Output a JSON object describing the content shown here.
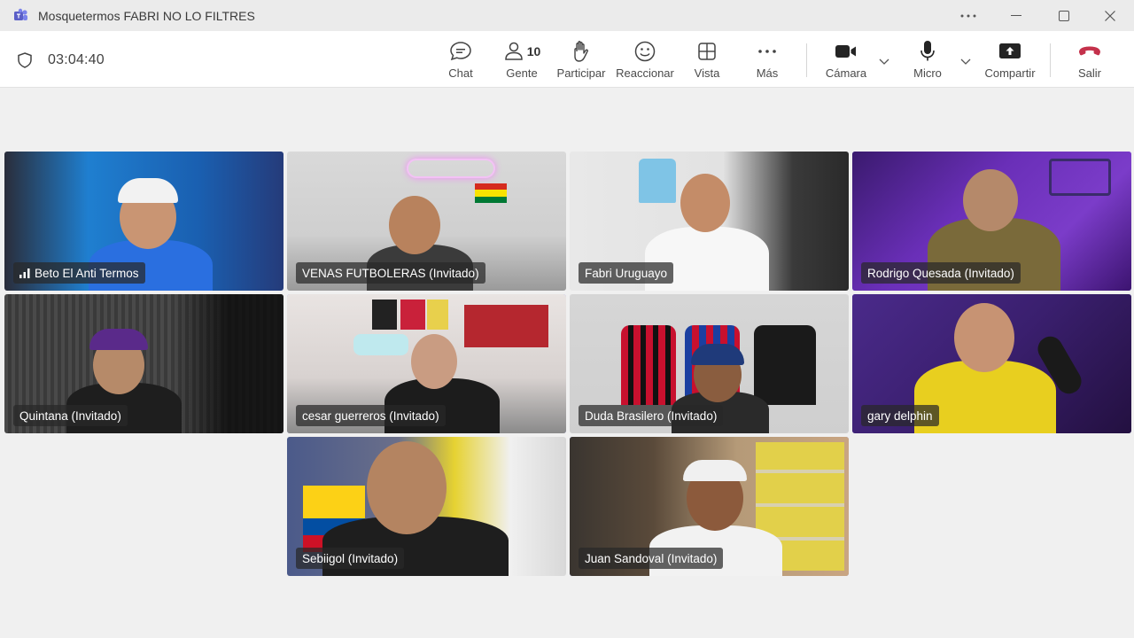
{
  "window": {
    "title": "Mosquetermos FABRI NO LO FILTRES"
  },
  "toolbar": {
    "timer": "03:04:40",
    "chat": "Chat",
    "people": "Gente",
    "people_count": "10",
    "raise_hand": "Participar",
    "react": "Reaccionar",
    "view": "Vista",
    "more": "Más",
    "camera": "Cámara",
    "mic": "Micro",
    "share": "Compartir",
    "leave": "Salir",
    "leave_color": "#c4314b"
  },
  "participants": [
    {
      "name": "Beto El Anti Termos",
      "speaking": true,
      "active": false
    },
    {
      "name": "VENAS FUTBOLERAS (Invitado)",
      "active": false
    },
    {
      "name": "Fabri Uruguayo",
      "active": false
    },
    {
      "name": "Rodrigo Quesada (Invitado)",
      "active": true
    },
    {
      "name": "Quintana (Invitado)",
      "active": false
    },
    {
      "name": "cesar guerreros (Invitado)",
      "active": true
    },
    {
      "name": "Duda Brasilero (Invitado)",
      "active": false
    },
    {
      "name": "gary delphin",
      "active": true
    },
    {
      "name": "Sebiigol (Invitado)",
      "active": false
    },
    {
      "name": "Juan Sandoval (Invitado)",
      "active": true
    }
  ],
  "colors": {
    "accent": "#7f85f5",
    "background": "#f0f0f0"
  }
}
